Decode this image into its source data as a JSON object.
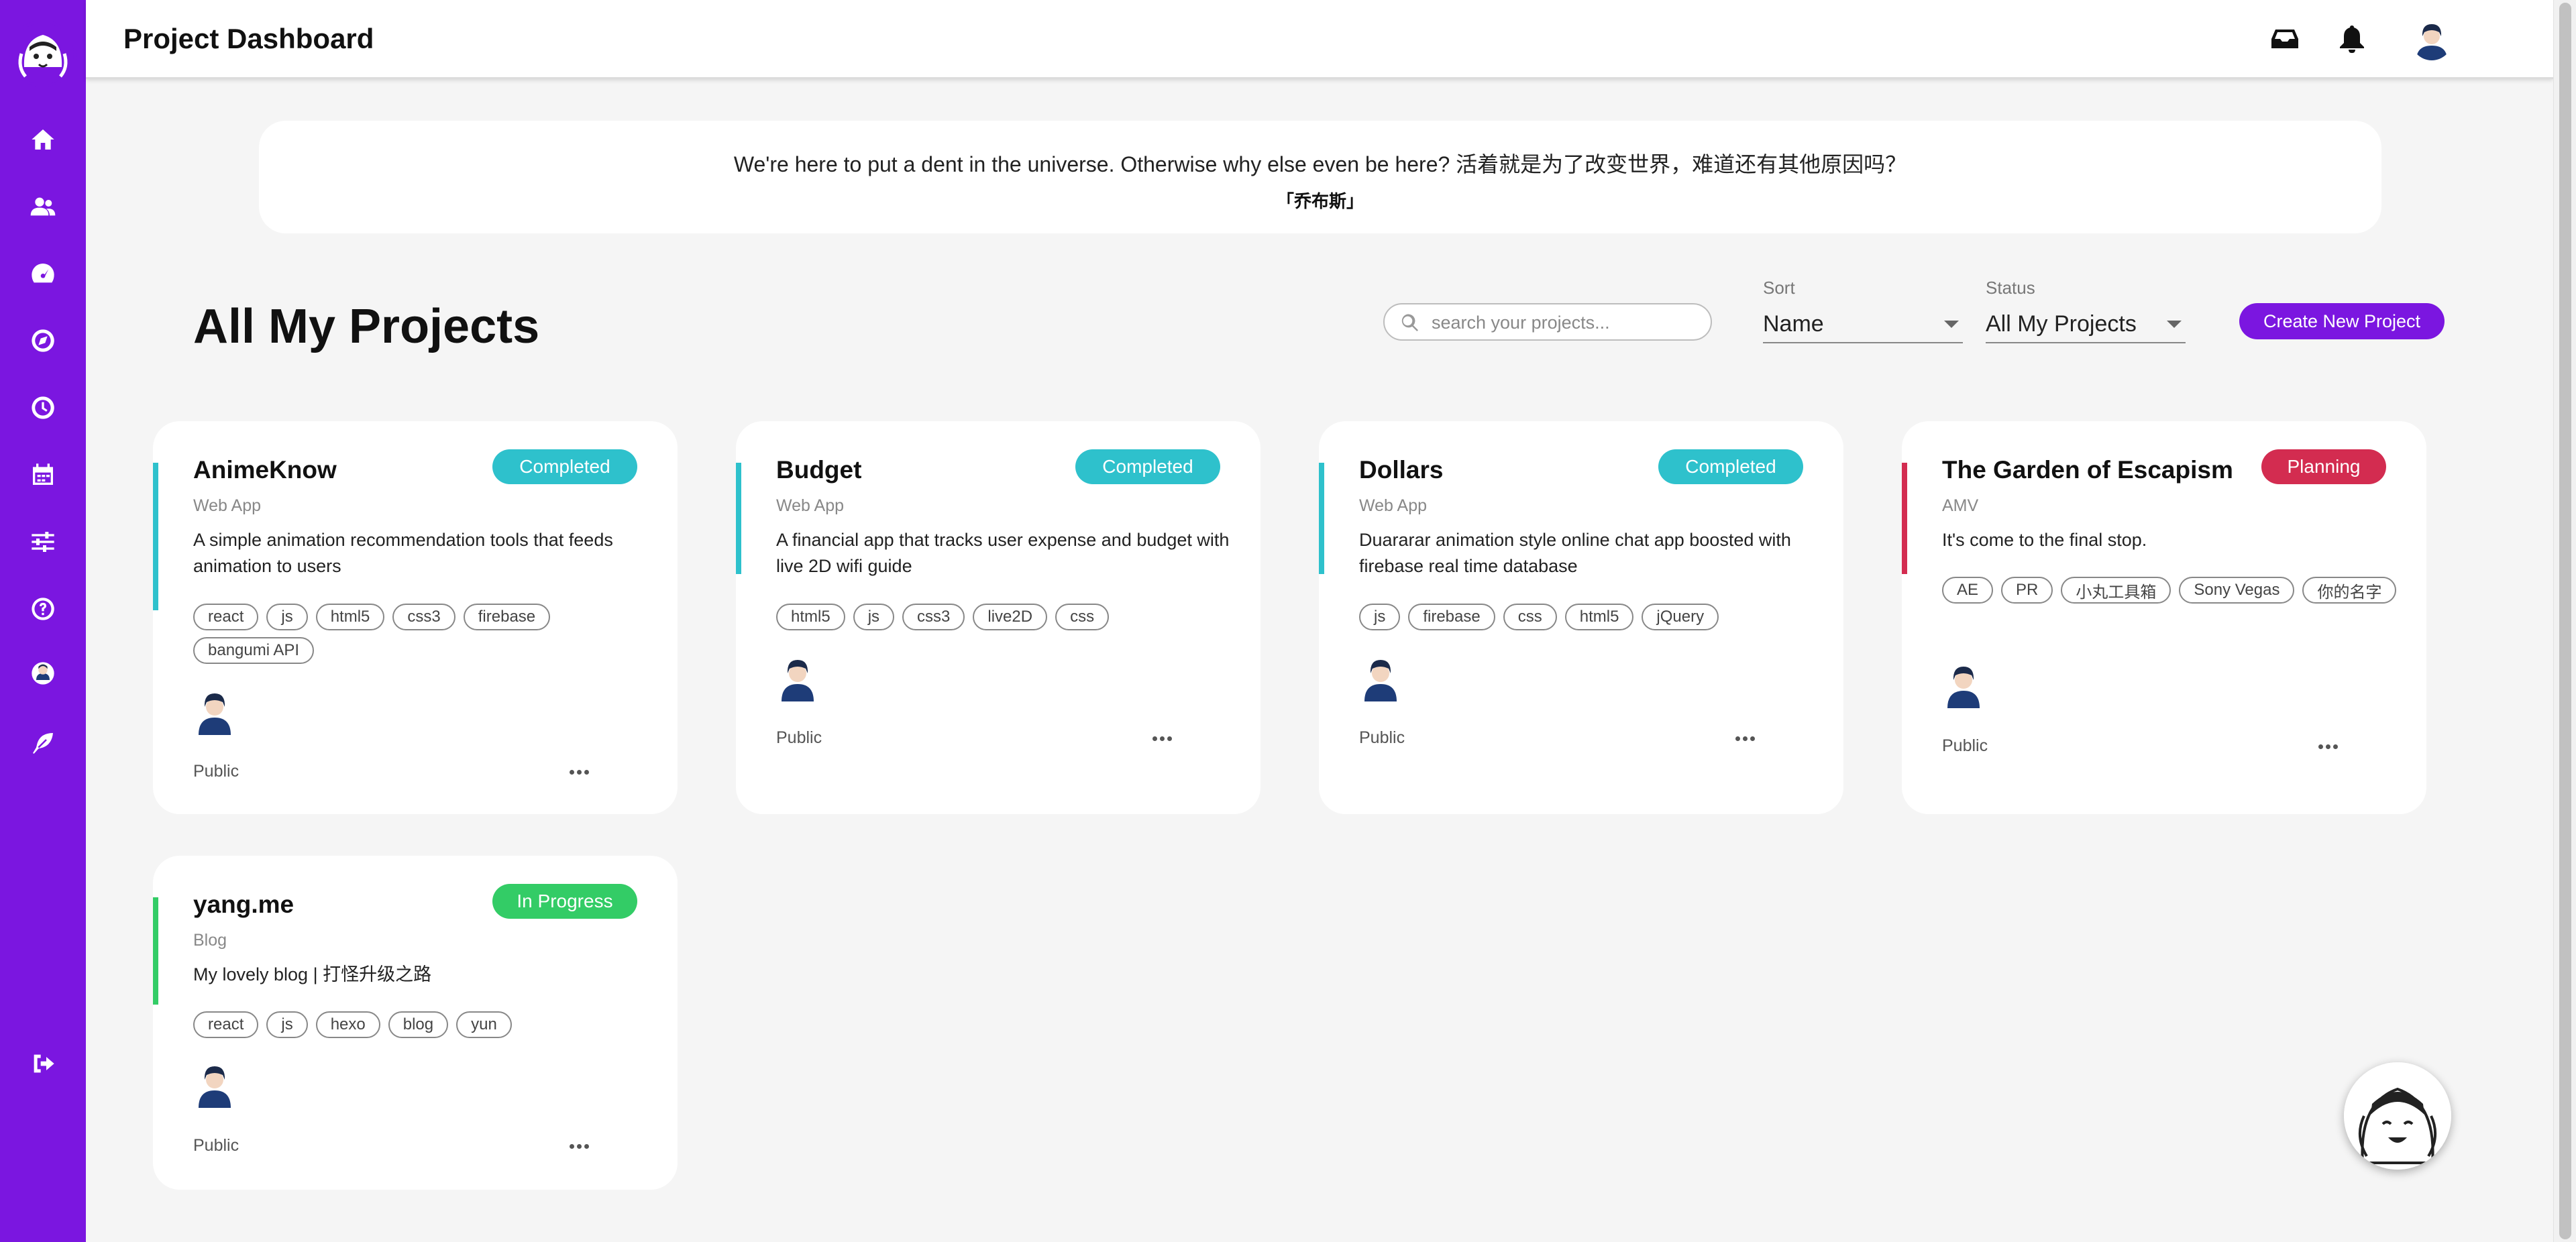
{
  "header": {
    "title": "Project Dashboard"
  },
  "quote": {
    "text": "We're here to put a dent in the universe. Otherwise why else even be here? 活着就是为了改变世界，难道还有其他原因吗？",
    "author": "「乔布斯」"
  },
  "page": {
    "title": "All My Projects"
  },
  "search": {
    "placeholder": "search your projects...",
    "value": ""
  },
  "sort": {
    "label": "Sort",
    "value": "Name"
  },
  "status_filter": {
    "label": "Status",
    "value": "All My Projects"
  },
  "create_button": {
    "label": "Create New Project"
  },
  "colors": {
    "accent": "#7b16e0",
    "completed": "#2ec1cc",
    "planning": "#d32c50",
    "in_progress": "#33cc66"
  },
  "projects": [
    {
      "title": "AnimeKnow",
      "status": "Completed",
      "type": "Web App",
      "description": "A simple animation recommendation tools that feeds animation to users",
      "tags": [
        "react",
        "js",
        "html5",
        "css3",
        "firebase",
        "bangumi API"
      ],
      "visibility": "Public"
    },
    {
      "title": "Budget",
      "status": "Completed",
      "type": "Web App",
      "description": "A financial app that tracks user expense and budget with live 2D wifi guide",
      "tags": [
        "html5",
        "js",
        "css3",
        "live2D",
        "css"
      ],
      "visibility": "Public"
    },
    {
      "title": "Dollars",
      "status": "Completed",
      "type": "Web App",
      "description": "Duararar animation style online chat app boosted with firebase real time database",
      "tags": [
        "js",
        "firebase",
        "css",
        "html5",
        "jQuery"
      ],
      "visibility": "Public"
    },
    {
      "title": "The Garden of Escapism",
      "status": "Planning",
      "type": "AMV",
      "description": "It's come to the final stop.",
      "tags": [
        "AE",
        "PR",
        "小丸工具箱",
        "Sony Vegas",
        "你的名字"
      ],
      "visibility": "Public"
    },
    {
      "title": "yang.me",
      "status": "In Progress",
      "type": "Blog",
      "description": "My lovely blog | 打怪升级之路",
      "tags": [
        "react",
        "js",
        "hexo",
        "blog",
        "yun"
      ],
      "visibility": "Public"
    }
  ]
}
